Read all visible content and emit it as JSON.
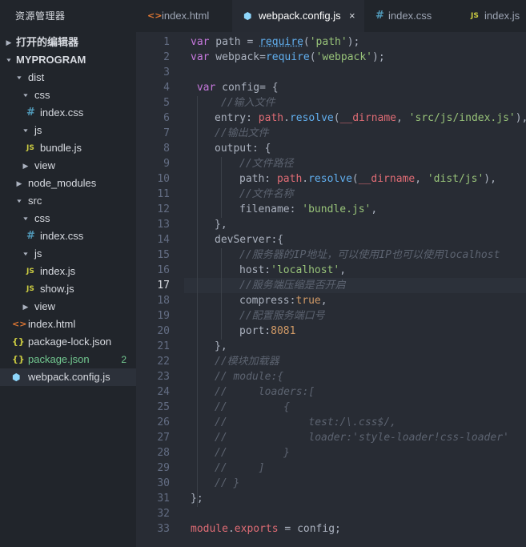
{
  "sidebar": {
    "title": "资源管理器",
    "open_editors": "打开的编辑器",
    "project": "MYPROGRAM",
    "items": [
      {
        "label": "dist"
      },
      {
        "label": "css"
      },
      {
        "label": "index.css"
      },
      {
        "label": "js"
      },
      {
        "label": "bundle.js"
      },
      {
        "label": "view"
      },
      {
        "label": "node_modules"
      },
      {
        "label": "src"
      },
      {
        "label": "css"
      },
      {
        "label": "index.css"
      },
      {
        "label": "js"
      },
      {
        "label": "index.js"
      },
      {
        "label": "show.js"
      },
      {
        "label": "view"
      },
      {
        "label": "index.html"
      },
      {
        "label": "package-lock.json"
      },
      {
        "label": "package.json",
        "badge": "2"
      },
      {
        "label": "webpack.config.js"
      }
    ]
  },
  "icons": {
    "css": "#",
    "js": "JS",
    "html": "<>",
    "json": "{}",
    "close": "×"
  },
  "tabs": [
    {
      "label": "index.html"
    },
    {
      "label": "webpack.config.js"
    },
    {
      "label": "index.css"
    },
    {
      "label": "index.js"
    }
  ],
  "editor": {
    "current_line": 17,
    "line_numbers": [
      "1",
      "2",
      "3",
      "4",
      "5",
      "6",
      "7",
      "8",
      "9",
      "10",
      "11",
      "12",
      "13",
      "14",
      "15",
      "16",
      "17",
      "18",
      "19",
      "20",
      "21",
      "22",
      "23",
      "24",
      "25",
      "26",
      "27",
      "28",
      "29",
      "30",
      "31",
      "32",
      "33"
    ],
    "code": {
      "l1": {
        "a": "var",
        "b": " path = ",
        "c": "require",
        "d": "(",
        "e": "'path'",
        "f": ");"
      },
      "l2": {
        "a": "var",
        "b": " webpack=",
        "c": "require",
        "d": "(",
        "e": "'webpack'",
        "f": ");"
      },
      "l4": {
        "a": " var",
        "b": " config= {"
      },
      "l5": {
        "a": "//输入文件"
      },
      "l6": {
        "a": "entry: ",
        "b": "path",
        "c": ".",
        "d": "resolve",
        "e": "(",
        "f": "__dirname",
        "g": ", ",
        "h": "'src/js/index.js'",
        "i": "),"
      },
      "l7": {
        "a": "//输出文件"
      },
      "l8": {
        "a": "output: {"
      },
      "l9": {
        "a": "//文件路径"
      },
      "l10": {
        "a": "path: ",
        "b": "path",
        "c": ".",
        "d": "resolve",
        "e": "(",
        "f": "__dirname",
        "g": ", ",
        "h": "'dist/js'",
        "i": "),"
      },
      "l11": {
        "a": "//文件名称"
      },
      "l12": {
        "a": "filename: ",
        "b": "'bundle.js'",
        "c": ","
      },
      "l13": {
        "a": "},"
      },
      "l14": {
        "a": "devServer:{"
      },
      "l15": {
        "a": "//服务器的IP地址，可以使用IP也可以使用localhost"
      },
      "l16": {
        "a": "host:",
        "b": "'localhost'",
        "c": ","
      },
      "l17": {
        "a": "//服务端压缩是否开启"
      },
      "l18": {
        "a": "compress:",
        "b": "true",
        "c": ","
      },
      "l19": {
        "a": "//配置服务端口号"
      },
      "l20": {
        "a": "port:",
        "b": "8081"
      },
      "l21": {
        "a": "},"
      },
      "l22": {
        "a": "//模块加载器"
      },
      "l23": {
        "a": "// module:{"
      },
      "l24": {
        "a": "//     loaders:["
      },
      "l25": {
        "a": "//         {"
      },
      "l26": {
        "a": "//             test:/\\.css$/,"
      },
      "l27": {
        "a": "//             loader:'style-loader!css-loader'"
      },
      "l28": {
        "a": "//         }"
      },
      "l29": {
        "a": "//     ]"
      },
      "l30": {
        "a": "// }"
      },
      "l31": {
        "a": "};"
      },
      "l33": {
        "a": "module",
        "b": ".",
        "c": "exports",
        "d": " = config;"
      }
    }
  }
}
